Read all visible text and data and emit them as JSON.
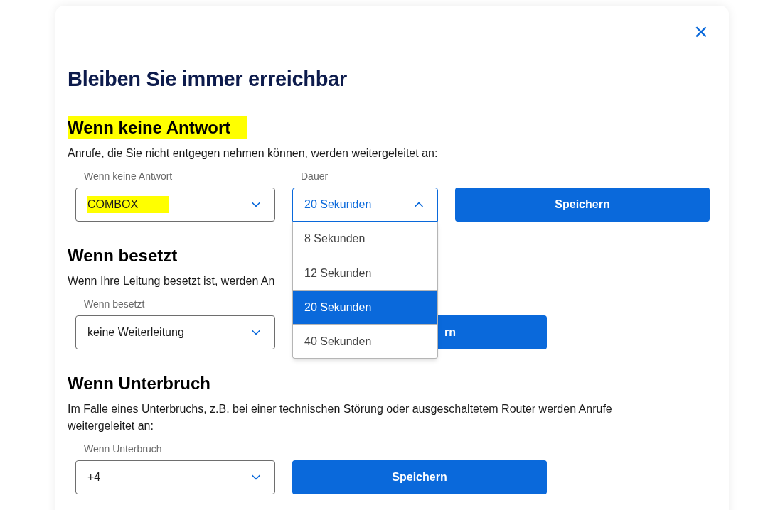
{
  "dialog": {
    "close": "×",
    "title": "Bleiben Sie immer erreichbar"
  },
  "sections": [
    {
      "heading": "Wenn keine Antwort",
      "highlighted": true,
      "description": "Anrufe, die Sie nicht entgegen nehmen können, werden weitergeleitet an:",
      "fields": [
        {
          "label": "Wenn keine Antwort",
          "value": "COMBOX",
          "highlighted": true,
          "open": false
        },
        {
          "label": "Dauer",
          "value": "20 Sekunden",
          "highlighted": false,
          "open": true,
          "options": [
            {
              "label": "8 Sekunden",
              "selected": false
            },
            {
              "label": "12 Sekunden",
              "selected": false
            },
            {
              "label": "20 Sekunden",
              "selected": true
            },
            {
              "label": "40 Sekunden",
              "selected": false
            }
          ]
        }
      ],
      "button": {
        "label": "Speichern",
        "covered": false
      }
    },
    {
      "heading": "Wenn besetzt",
      "highlighted": false,
      "description": "Wenn Ihre Leitung besetzt ist, werden An",
      "fields": [
        {
          "label": "Wenn besetzt",
          "value": "keine Weiterleitung",
          "highlighted": false,
          "open": false
        }
      ],
      "button": {
        "label": "rn",
        "covered": true
      }
    },
    {
      "heading": "Wenn Unterbruch",
      "highlighted": false,
      "description": "Im Falle eines Unterbruchs, z.B. bei einer technischen Störung oder ausgeschaltetem Router werden Anrufe weitergeleitet an:",
      "fields": [
        {
          "label": "Wenn Unterbruch",
          "value": "+4",
          "highlighted": false,
          "open": false
        }
      ],
      "button": {
        "label": "Speichern",
        "covered": false
      }
    }
  ]
}
